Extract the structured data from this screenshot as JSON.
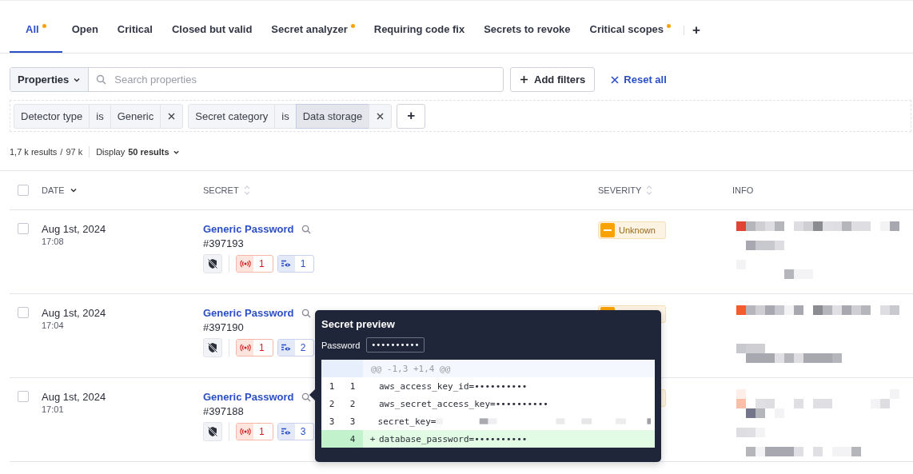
{
  "tabs": [
    {
      "label": "All",
      "selected": true,
      "dot": true
    },
    {
      "label": "Open",
      "selected": false,
      "dot": false
    },
    {
      "label": "Critical",
      "selected": false,
      "dot": false
    },
    {
      "label": "Closed but valid",
      "selected": false,
      "dot": false
    },
    {
      "label": "Secret analyzer",
      "selected": false,
      "dot": true
    },
    {
      "label": "Requiring code fix",
      "selected": false,
      "dot": false
    },
    {
      "label": "Secrets to revoke",
      "selected": false,
      "dot": false
    },
    {
      "label": "Critical scopes",
      "selected": false,
      "dot": true
    }
  ],
  "add_tab": "+",
  "filter_bar": {
    "properties_label": "Properties",
    "search_placeholder": "Search properties",
    "add_filters": "Add filters",
    "reset_all": "Reset all"
  },
  "filter_chips": [
    {
      "field": "Detector type",
      "operator": "is",
      "value": "Generic",
      "selected": false
    },
    {
      "field": "Secret category",
      "operator": "is",
      "value": "Data storage",
      "selected": true
    }
  ],
  "add_chip": "+",
  "results": {
    "count": "1,7 k results",
    "separator": "/",
    "total": "97 k",
    "display_label": "Display",
    "display_value": "50 results"
  },
  "table": {
    "select_all_checked": false,
    "columns": [
      {
        "label": "DATE",
        "kind": "sorted"
      },
      {
        "label": "SECRET",
        "kind": "sortable"
      },
      {
        "label": "SEVERITY",
        "kind": "sortable"
      },
      {
        "label": "INFO",
        "kind": "plain"
      }
    ],
    "rows": [
      {
        "checked": false,
        "date": "Aug 1st, 2024",
        "time": "17:08",
        "secret": "Generic Password",
        "id": "#397193",
        "incidents": "1",
        "viewers": "1",
        "severity": {
          "kind": "unknown",
          "label": "Unknown"
        }
      },
      {
        "checked": false,
        "date": "Aug 1st, 2024",
        "time": "17:04",
        "secret": "Generic Password",
        "id": "#397190",
        "incidents": "1",
        "viewers": "2",
        "severity": {
          "kind": "unknown"
        }
      },
      {
        "checked": false,
        "date": "Aug 1st, 2024",
        "time": "17:01",
        "secret": "Generic Password",
        "id": "#397188",
        "incidents": "1",
        "viewers": "3",
        "severity": {
          "kind": "unknown"
        }
      }
    ]
  },
  "secret_preview": {
    "title": "Secret preview",
    "password_label": "Password",
    "password_value": "••••••••••",
    "hunk_header": "@@ -1,3 +1,4 @@",
    "lines": [
      {
        "kind": "context",
        "old": "1",
        "new": "1",
        "text": "aws_access_key_id=••••••••••"
      },
      {
        "kind": "context",
        "old": "2",
        "new": "2",
        "text": "aws_secret_access_key=••••••••••"
      },
      {
        "kind": "context",
        "old": "3",
        "new": "3",
        "text": "secret_key=",
        "redacted": true
      },
      {
        "kind": "added",
        "new": "4",
        "sign": "+",
        "text": "database_password=••••••••••"
      }
    ]
  }
}
